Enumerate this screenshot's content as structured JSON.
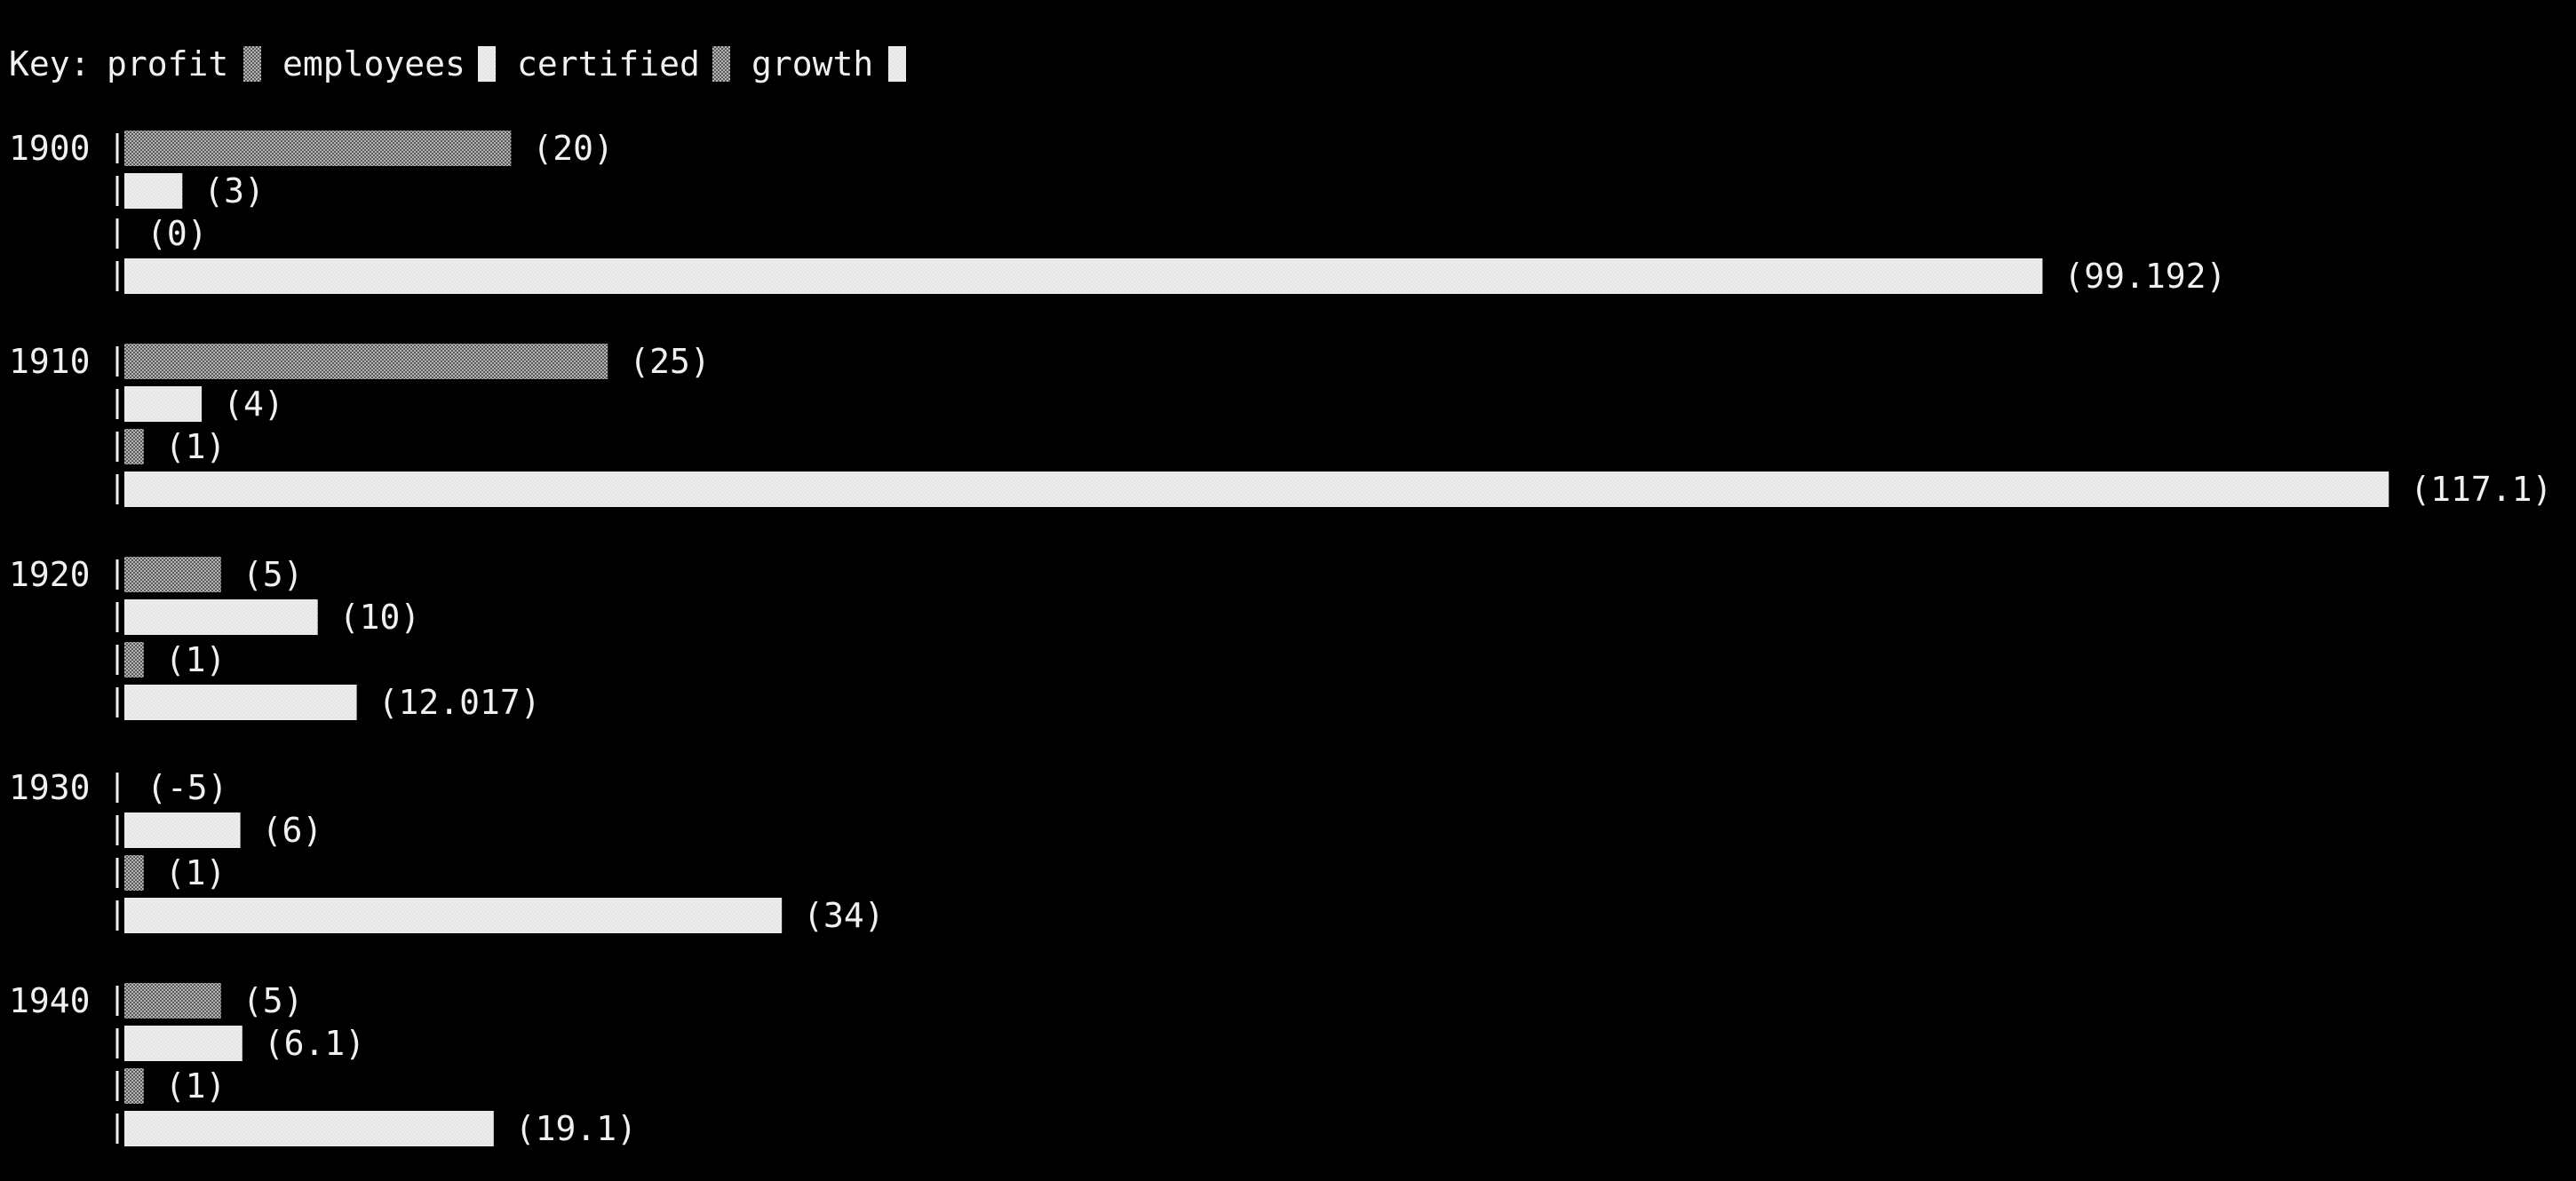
{
  "chart_data": {
    "type": "bar",
    "orientation": "horizontal",
    "key_label": "Key:",
    "categories": [
      "1900",
      "1910",
      "1920",
      "1930",
      "1940"
    ],
    "series": [
      {
        "name": "profit",
        "pattern": "dark-shade",
        "values": [
          20,
          25,
          5,
          -5,
          5
        ],
        "value_labels": [
          "(20)",
          "(25)",
          "(5)",
          "(-5)",
          "(5)"
        ]
      },
      {
        "name": "employees",
        "pattern": "light-solid",
        "values": [
          3,
          4,
          10,
          6,
          6.1
        ],
        "value_labels": [
          "(3)",
          "(4)",
          "(10)",
          "(6)",
          "(6.1)"
        ]
      },
      {
        "name": "certified",
        "pattern": "dark-shade",
        "values": [
          0,
          1,
          1,
          1,
          1
        ],
        "value_labels": [
          "(0)",
          "(1)",
          "(1)",
          "(1)",
          "(1)"
        ]
      },
      {
        "name": "growth",
        "pattern": "light-solid",
        "values": [
          99.192,
          117.1,
          12.017,
          34,
          19.1
        ],
        "value_labels": [
          "(99.192)",
          "(117.1)",
          "(12.017)",
          "(34)",
          "(19.1)"
        ]
      }
    ],
    "legend_position": "top-left",
    "colors": {
      "background": "#000000",
      "foreground": "#f0f0f0",
      "dark_shade": "#8c8c8c",
      "light_solid": "#ececec"
    }
  }
}
